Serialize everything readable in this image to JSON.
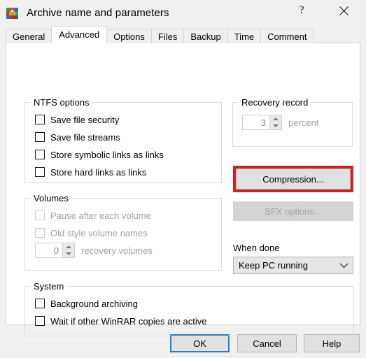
{
  "window": {
    "title": "Archive name and parameters",
    "icon": "winrar-books-icon",
    "help_label": "?",
    "close_label": "✕"
  },
  "tabs": [
    {
      "label": "General",
      "selected": false
    },
    {
      "label": "Advanced",
      "selected": true
    },
    {
      "label": "Options",
      "selected": false
    },
    {
      "label": "Files",
      "selected": false
    },
    {
      "label": "Backup",
      "selected": false
    },
    {
      "label": "Time",
      "selected": false
    },
    {
      "label": "Comment",
      "selected": false
    }
  ],
  "ntfs_options": {
    "title": "NTFS options",
    "items": [
      {
        "label": "Save file security",
        "checked": false,
        "enabled": true
      },
      {
        "label": "Save file streams",
        "checked": false,
        "enabled": true
      },
      {
        "label": "Store symbolic links as links",
        "checked": false,
        "enabled": true
      },
      {
        "label": "Store hard links as links",
        "checked": false,
        "enabled": true
      }
    ]
  },
  "volumes": {
    "title": "Volumes",
    "items": [
      {
        "label": "Pause after each volume",
        "checked": false,
        "enabled": false
      },
      {
        "label": "Old style volume names",
        "checked": false,
        "enabled": false
      }
    ],
    "recovery_volumes": {
      "value": "0",
      "suffix": "recovery volumes",
      "enabled": false
    }
  },
  "system": {
    "title": "System",
    "items": [
      {
        "label": "Background archiving",
        "checked": false,
        "enabled": true
      },
      {
        "label": "Wait if other WinRAR copies are active",
        "checked": false,
        "enabled": true
      }
    ]
  },
  "recovery_record": {
    "title": "Recovery record",
    "value": "3",
    "suffix": "percent",
    "enabled": false
  },
  "buttons": {
    "compression": {
      "label": "Compression...",
      "enabled": true,
      "highlighted": true
    },
    "sfx_options": {
      "label": "SFX options...",
      "enabled": false
    }
  },
  "when_done": {
    "label": "When done",
    "selected": "Keep PC running"
  },
  "footer": {
    "ok": "OK",
    "cancel": "Cancel",
    "help": "Help"
  },
  "colors": {
    "highlight_red": "#cf2026",
    "focus_blue": "#2a7fbd",
    "dialog_bg": "#f0f0f0",
    "panel_bg": "#ffffff"
  }
}
